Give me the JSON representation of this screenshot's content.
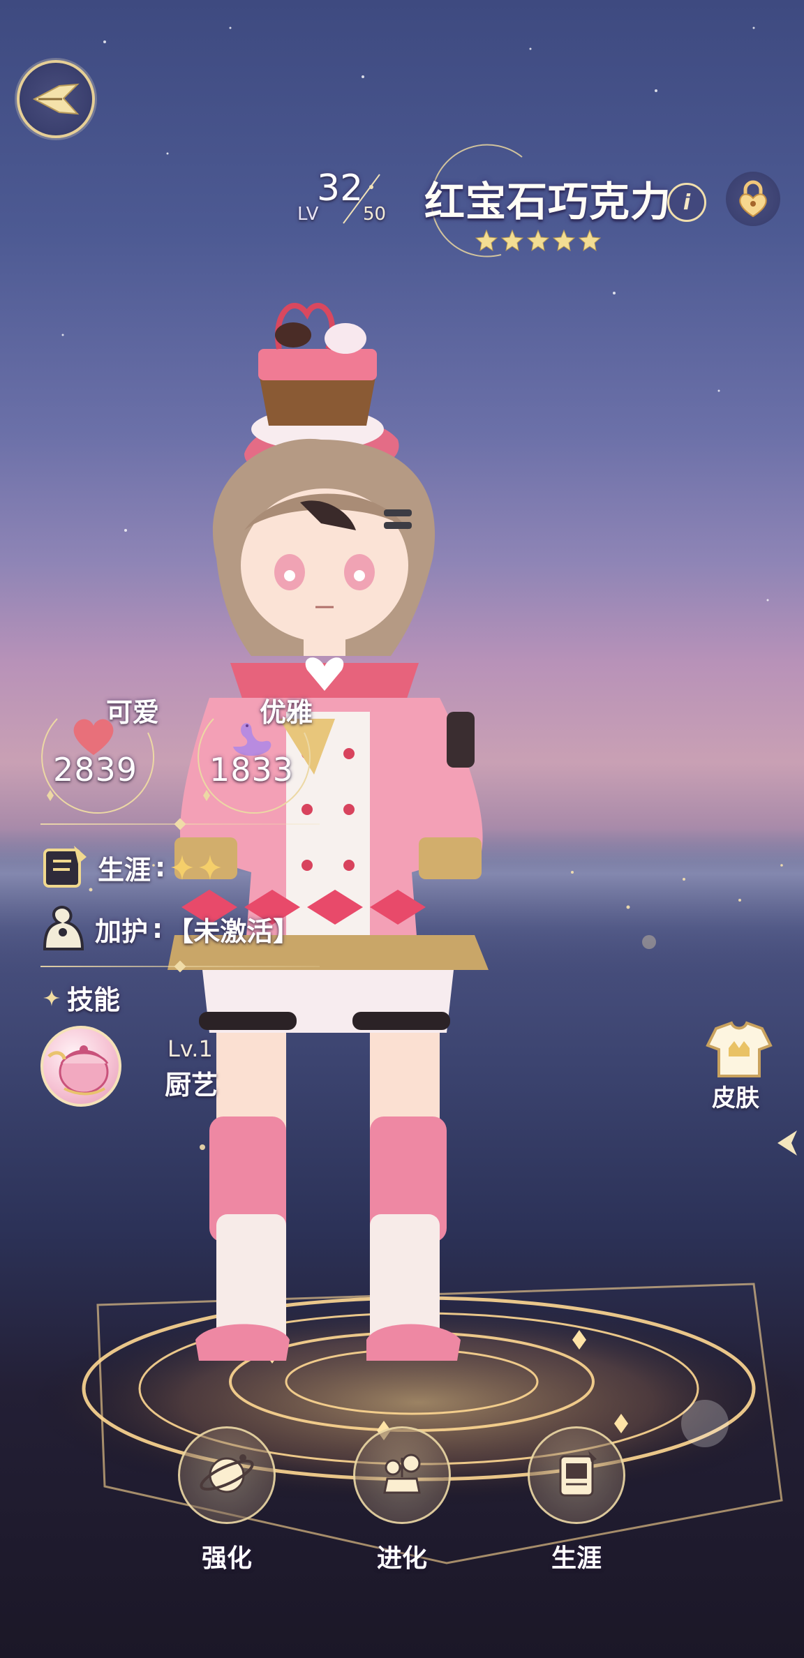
{
  "character": {
    "name": "红宝石巧克力",
    "level_label": "LV",
    "level": "32",
    "level_max": "50",
    "star_count": 5
  },
  "stats": {
    "cute": {
      "label": "可爱",
      "value": "2839",
      "icon": "heart-icon"
    },
    "elegant": {
      "label": "优雅",
      "value": "1833",
      "icon": "swan-icon"
    }
  },
  "career": {
    "label": "生涯",
    "colon": ":",
    "stars": 2
  },
  "protection": {
    "label": "加护",
    "colon": ":",
    "value": "【未激活】"
  },
  "skills": {
    "header": "技能",
    "items": [
      {
        "level": "Lv.1",
        "name": "厨艺",
        "icon": "cooking-pot-icon"
      }
    ]
  },
  "side": {
    "skin_label": "皮肤"
  },
  "bottom_nav": [
    {
      "label": "强化",
      "icon": "planet-icon"
    },
    {
      "label": "进化",
      "icon": "evolve-icon"
    },
    {
      "label": "生涯",
      "icon": "career-book-icon"
    }
  ],
  "colors": {
    "gold": "#e6cf96",
    "heart": "#e8707a",
    "swan": "#b88be0"
  }
}
